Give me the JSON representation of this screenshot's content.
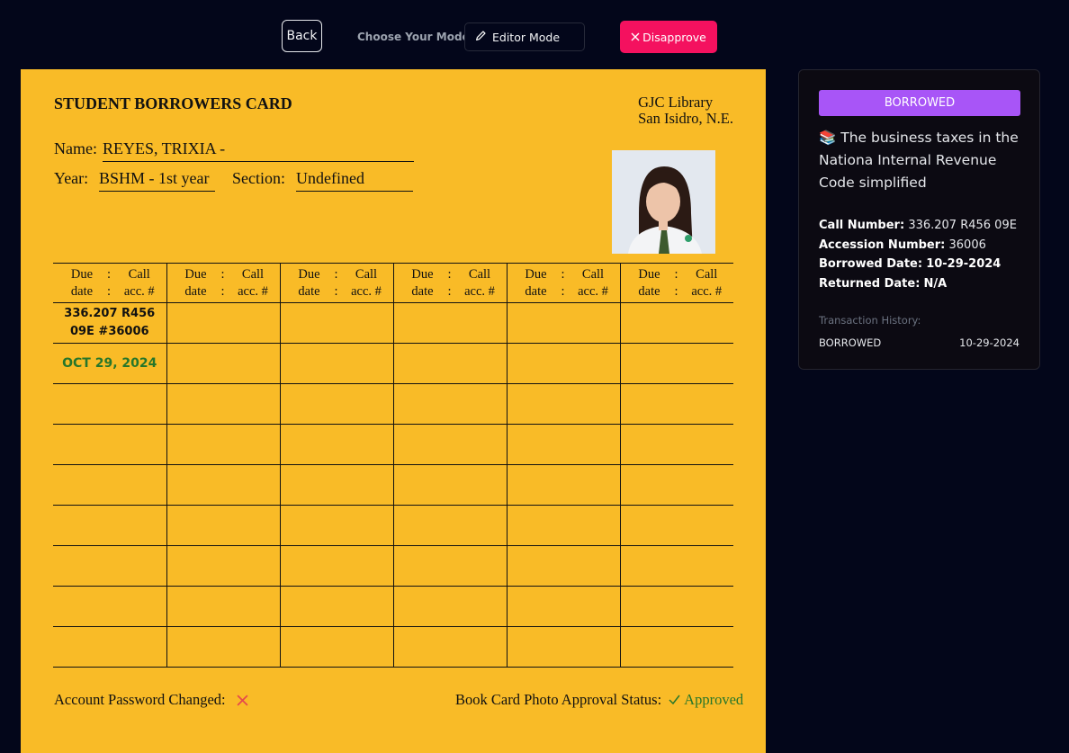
{
  "toolbar": {
    "back_label": "Back",
    "mode_label": "Choose Your Mode:",
    "mode_value": "Editor Mode",
    "disapprove_label": "Disapprove"
  },
  "card": {
    "title": "STUDENT BORROWERS CARD",
    "library_line1": "GJC Library",
    "library_line2": "San Isidro, N.E.",
    "name_label": "Name:",
    "name_value": "REYES, TRIXIA -",
    "year_label": "Year:",
    "year_value": "BSHM - 1st year",
    "section_label": "Section:",
    "section_value": "Undefined",
    "col_header": {
      "due": "Due",
      "date": "date",
      "colon": ":",
      "call": "Call",
      "acc": "acc. #"
    },
    "entries": [
      {
        "call_line1": "336.207 R456",
        "call_line2": "09E #36006",
        "date": "OCT 29, 2024"
      }
    ],
    "password_label": "Account Password Changed:",
    "approval_label": "Book Card Photo Approval Status:",
    "approval_value": "Approved"
  },
  "panel": {
    "status": "BORROWED",
    "book_title": "The business taxes in the Nationa Internal Revenue Code simplified",
    "book_icon": "📚",
    "call_number_label": "Call Number:",
    "call_number": "336.207 R456 09E",
    "accession_label": "Accession Number:",
    "accession": "36006",
    "borrowed_label": "Borrowed Date:",
    "borrowed_date": "10-29-2024",
    "returned_label": "Returned Date:",
    "returned_date": "N/A",
    "history_label": "Transaction History:",
    "history": [
      {
        "status": "BORROWED",
        "date": "10-29-2024"
      }
    ]
  },
  "colors": {
    "card": "#f9bb27",
    "accent_pink": "#f4115f",
    "badge_purple": "#a855f7",
    "approved_green": "#27762a",
    "x_red": "#e5484d"
  }
}
